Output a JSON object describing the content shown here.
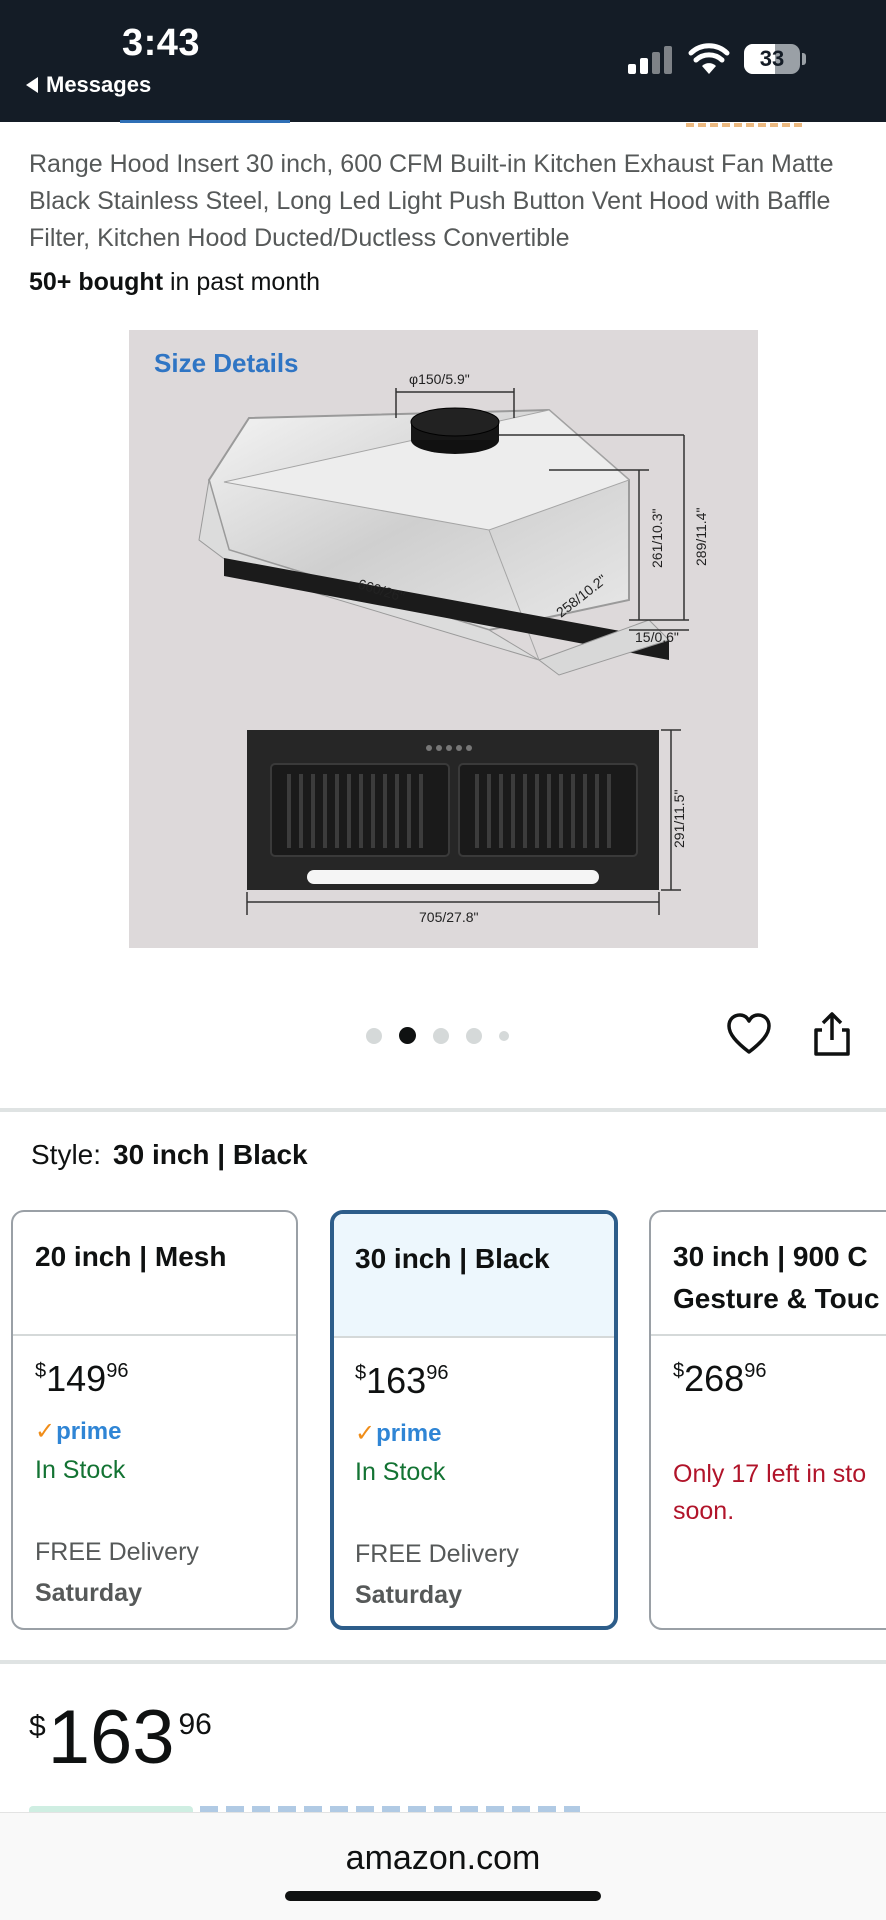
{
  "status_bar": {
    "time": "3:43",
    "back_label": "Messages",
    "battery": "33",
    "icons": [
      "signal-icon",
      "wifi-icon",
      "battery-icon"
    ]
  },
  "product": {
    "title": "Range Hood Insert 30 inch, 600 CFM Built-in Kitchen Exhaust Fan Matte Black Stainless Steel, Long Led Light Push Button Vent Hood with Baffle Filter, Kitchen Hood Ducted/Ductless Convertible",
    "bought_bold": "50+ bought",
    "bought_rest": " in past month"
  },
  "image": {
    "heading": "Size Details",
    "dimensions": {
      "duct": "φ150/5.9\"",
      "height_a": "261/10.3\"",
      "height_b": "289/11.4\"",
      "width_top": "660/26\"",
      "depth": "258/10.2\"",
      "lip": "15/0.6\"",
      "depth_front": "291/11.5\"",
      "width_bottom": "705/27.8\""
    },
    "carousel_total": 5,
    "carousel_active": 2
  },
  "actions": {
    "icons": [
      "heart-icon",
      "share-icon"
    ]
  },
  "style": {
    "label": "Style:",
    "selected": "30 inch | Black",
    "options": [
      {
        "name": "20 inch | Mesh",
        "price_whole": "149",
        "price_frac": "96",
        "currency": "$",
        "prime": "prime",
        "stock": "In Stock",
        "delivery": "FREE Delivery",
        "delivery_day": "Saturday"
      },
      {
        "name": "30 inch | Black",
        "price_whole": "163",
        "price_frac": "96",
        "currency": "$",
        "prime": "prime",
        "stock": "In Stock",
        "delivery": "FREE Delivery",
        "delivery_day": "Saturday"
      },
      {
        "name_line1": "30 inch | 900 C",
        "name_line2": "Gesture & Touc",
        "price_whole": "268",
        "price_frac": "96",
        "currency": "$",
        "stock_line1": "Only 17 left in sto",
        "stock_line2": "soon."
      }
    ]
  },
  "price": {
    "currency": "$",
    "whole": "163",
    "frac": "96"
  },
  "browser": {
    "url": "amazon.com"
  },
  "colors": {
    "status_bg": "#141c26",
    "selected_border": "#2d5d8a",
    "selected_bg": "#edf7fd",
    "in_stock": "#137333",
    "low_stock": "#b1142a",
    "prime_blue": "#2f85d5",
    "prime_check": "#f08d19",
    "image_heading": "#2f75c4"
  }
}
